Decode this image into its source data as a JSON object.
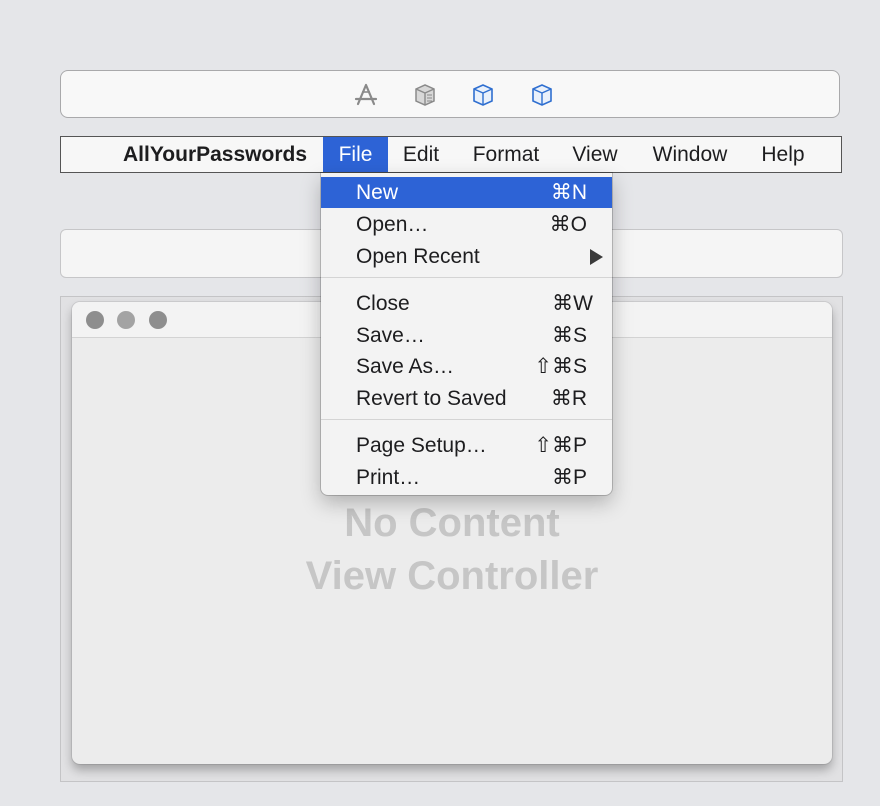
{
  "toolbar": {
    "icons": [
      "app-store-icon",
      "object-cube-icon",
      "box-icon",
      "box-icon"
    ]
  },
  "menubar": {
    "app_name": "AllYourPasswords",
    "items": [
      "File",
      "Edit",
      "Format",
      "View",
      "Window",
      "Help"
    ],
    "active": "File"
  },
  "file_menu": {
    "items": [
      {
        "label": "New",
        "shortcut": "⌘N"
      },
      {
        "label": "Open…",
        "shortcut": "⌘O"
      },
      {
        "label": "Open Recent",
        "shortcut": ""
      },
      {
        "label": "Close",
        "shortcut": "⌘W"
      },
      {
        "label": "Save…",
        "shortcut": "⌘S"
      },
      {
        "label": "Save As…",
        "shortcut": "⇧⌘S"
      },
      {
        "label": "Revert to Saved",
        "shortcut": "⌘R"
      },
      {
        "label": "Page Setup…",
        "shortcut": "⇧⌘P"
      },
      {
        "label": "Print…",
        "shortcut": "⌘P"
      }
    ],
    "highlighted": "New"
  },
  "window": {
    "placeholder_line1": "No Content",
    "placeholder_line2": "View Controller"
  },
  "colors": {
    "accent": "#2d63d6",
    "icon_blue": "#2f6fd0",
    "background": "#e5e6e9"
  }
}
